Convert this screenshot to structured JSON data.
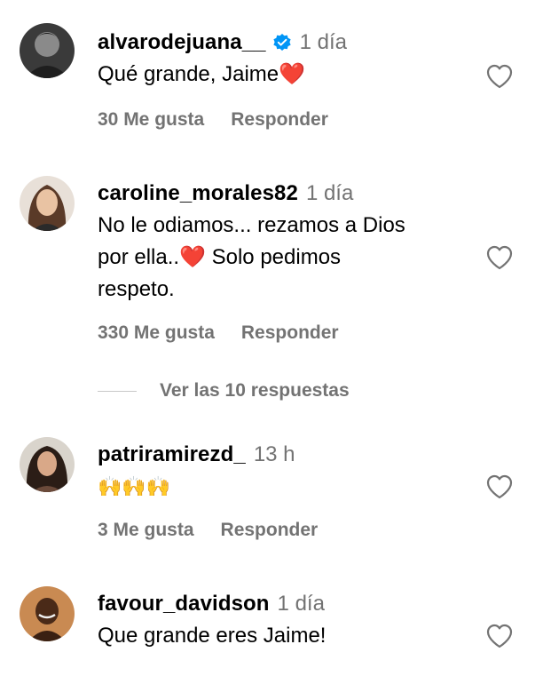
{
  "comments": [
    {
      "user": "alvarodejuana__",
      "verified": true,
      "time": "1 día",
      "text": "Qué grande, Jaime",
      "emoji": "❤️",
      "likes": "30 Me gusta",
      "reply": "Responder"
    },
    {
      "user": "caroline_morales82",
      "verified": false,
      "time": "1 día",
      "text_line1": "No le odiamos... rezamos a Dios",
      "text_line2a": "por ella..",
      "emoji": "❤️",
      "text_line2b": " Solo pedimos",
      "text_line3": "respeto.",
      "likes": "330 Me gusta",
      "reply": "Responder"
    },
    {
      "user": "patriramirezd_",
      "verified": false,
      "time": "13 h",
      "text": "🙌🙌🙌",
      "likes": "3 Me gusta",
      "reply": "Responder"
    },
    {
      "user": "favour_davidson",
      "verified": false,
      "time": "1 día",
      "text": "Que grande eres Jaime!"
    }
  ],
  "view_replies": "Ver las 10 respuestas",
  "icons": {
    "like": "heart-outline-icon",
    "verified": "verified-badge-icon"
  },
  "colors": {
    "secondary_text": "#737373",
    "verified_blue": "#0095f6",
    "heart_red": "#e0202c"
  }
}
